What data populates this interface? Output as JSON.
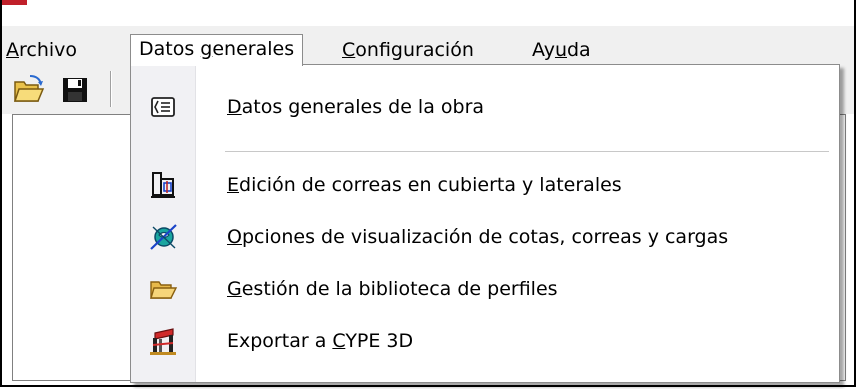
{
  "menubar": {
    "items": [
      {
        "pre": "",
        "accel": "A",
        "post": "rchivo"
      },
      {
        "pre": "Datos ",
        "accel": "g",
        "post": "enerales"
      },
      {
        "pre": "",
        "accel": "C",
        "post": "onfiguración"
      },
      {
        "pre": "Ay",
        "accel": "u",
        "post": "da"
      }
    ]
  },
  "toolbar": {
    "buttons": [
      "open-folder-icon",
      "save-disk-icon"
    ]
  },
  "dropdown": {
    "items": [
      {
        "icon": "general-data-icon",
        "pre": "",
        "accel": "D",
        "post": "atos generales de la obra"
      },
      {
        "icon": "purlin-edit-icon",
        "pre": "",
        "accel": "E",
        "post": "dición de correas en cubierta y laterales"
      },
      {
        "icon": "visualization-options-icon",
        "pre": "",
        "accel": "O",
        "post": "pciones de visualización de cotas, correas y cargas"
      },
      {
        "icon": "profile-library-folder-icon",
        "pre": "",
        "accel": "G",
        "post": "estión de la biblioteca de perfiles"
      },
      {
        "icon": "export-cype3d-icon",
        "pre": "Exportar a ",
        "accel": "C",
        "post": "YPE 3D"
      }
    ]
  },
  "colors": {
    "menubar_bg": "#f0f0f0",
    "menu_gutter": "#f1f1f4",
    "accent_red": "#c0202a"
  }
}
